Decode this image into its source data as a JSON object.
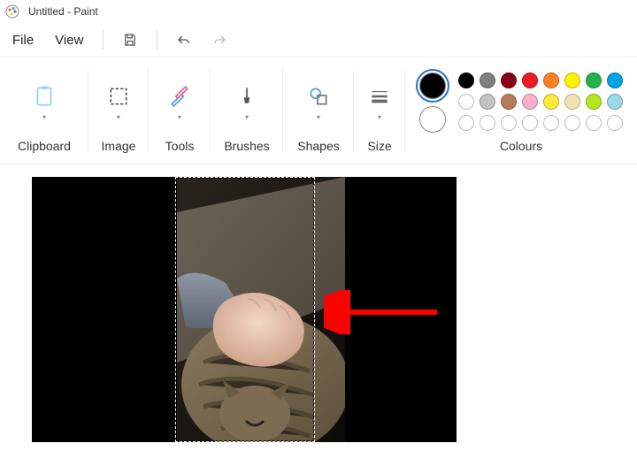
{
  "titlebar": {
    "title": "Untitled - Paint"
  },
  "menu": {
    "file": "File",
    "view": "View"
  },
  "ribbon": {
    "clipboard": "Clipboard",
    "image": "Image",
    "tools": "Tools",
    "brushes": "Brushes",
    "shapes": "Shapes",
    "size": "Size",
    "colours": "Colours"
  },
  "colours": {
    "primary": "#000000",
    "secondary": "#ffffff",
    "palette": [
      "#000000",
      "#7f7f7f",
      "#880015",
      "#ed1c24",
      "#ff7f27",
      "#fff200",
      "#22b14c",
      "#00a2e8",
      "#ffffff",
      "#c3c3c3",
      "#b97a57",
      "#ffaec9",
      "#ffe93b",
      "#efe4b0",
      "#b5e61d",
      "#99d9ea",
      "#ffffff",
      "#ffffff",
      "#ffffff",
      "#ffffff",
      "#ffffff",
      "#ffffff",
      "#ffffff",
      "#ffffff"
    ]
  },
  "annotation": {
    "arrow_color": "#ff0000"
  }
}
